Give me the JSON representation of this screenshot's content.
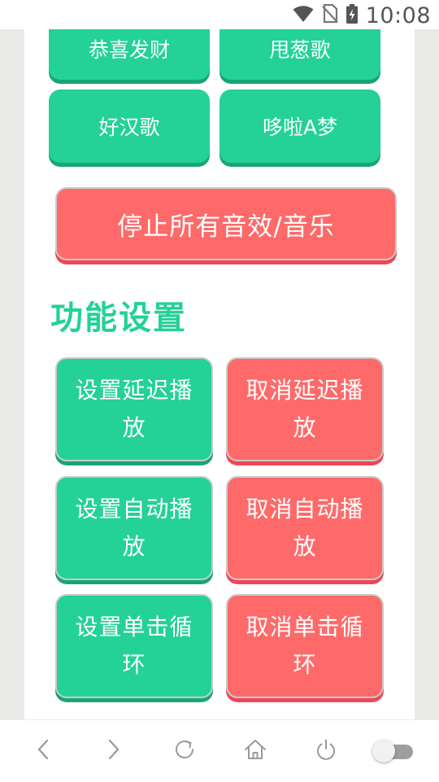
{
  "status_bar": {
    "time": "10:08",
    "icons": [
      "wifi-icon",
      "no-sim-icon",
      "battery-charging-icon"
    ]
  },
  "songs": [
    {
      "label": "恭喜发财"
    },
    {
      "label": "甩葱歌"
    },
    {
      "label": "好汉歌"
    },
    {
      "label": "哆啦A梦"
    }
  ],
  "stop_all": {
    "label": "停止所有音效/音乐"
  },
  "settings": {
    "title": "功能设置",
    "buttons": [
      {
        "label": "设置延迟播放"
      },
      {
        "label": "取消延迟播放"
      },
      {
        "label": "设置自动播放"
      },
      {
        "label": "取消自动播放"
      },
      {
        "label": "设置单击循环"
      },
      {
        "label": "取消单击循环"
      }
    ]
  },
  "bottom_nav": {
    "icons": [
      "back-icon",
      "forward-icon",
      "refresh-icon",
      "home-icon",
      "power-icon",
      "toggle-switch"
    ],
    "toggle_on": false
  },
  "colors": {
    "green": "#24d197",
    "red": "#fe6a69",
    "title_green": "#24d197"
  }
}
